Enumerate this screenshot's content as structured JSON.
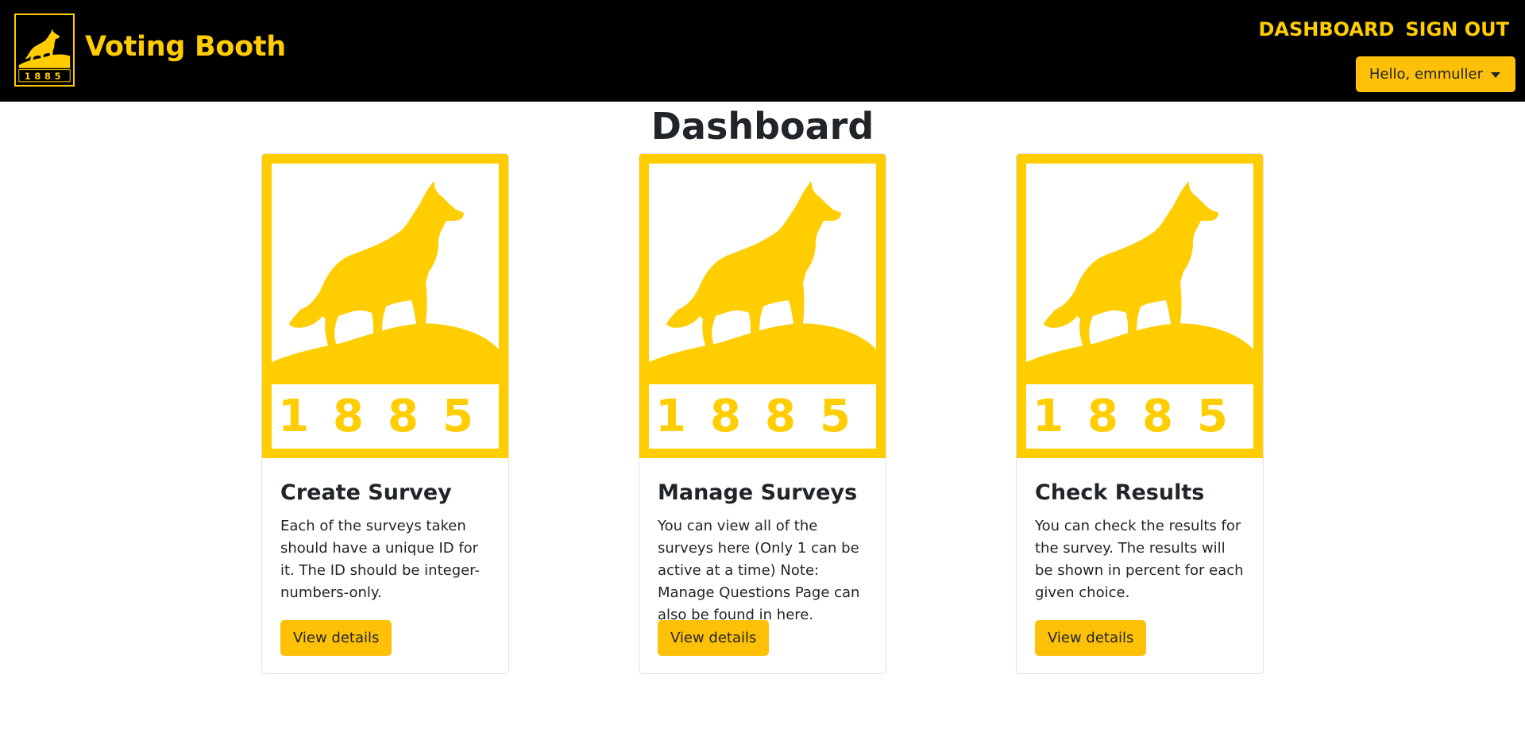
{
  "app": {
    "brand_title": "Voting Booth",
    "logo_year": "1885",
    "brand_color": "#ffcd00",
    "accent_color": "#ffc107"
  },
  "nav": {
    "links": [
      "DASHBOARD",
      "SIGN OUT"
    ],
    "user_menu_label": "Hello, emmuller"
  },
  "main": {
    "title": "Dashboard",
    "cards": [
      {
        "image_year": "1885",
        "title": "Create Survey",
        "text": "Each of the surveys taken should have a unique ID for it. The ID should be integer-numbers-only.",
        "button_label": "View details"
      },
      {
        "image_year": "1885",
        "title": "Manage Surveys",
        "text": "You can view all of the surveys here (Only 1 can be active at a time) Note: Manage Questions Page can also be found in here.",
        "button_label": "View details"
      },
      {
        "image_year": "1885",
        "title": "Check Results",
        "text": "You can check the results for the survey. The results will be shown in percent for each given choice.",
        "button_label": "View details"
      }
    ]
  }
}
